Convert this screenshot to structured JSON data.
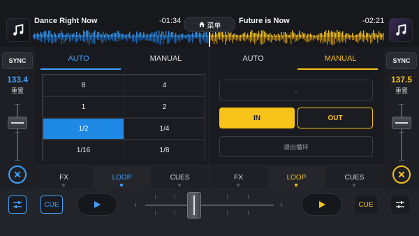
{
  "deck_a": {
    "title": "Dance Right Now",
    "time": "-01:34",
    "bpm": "133.4",
    "reset": "重置",
    "sync": "SYNC",
    "accent": "#3ea2ff",
    "tabs": [
      "AUTO",
      "MANUAL"
    ],
    "active_tab": "AUTO",
    "loop_sizes": [
      "8",
      "4",
      "1",
      "2",
      "1/2",
      "1/4",
      "1/16",
      "1/8"
    ],
    "selected_loop": "1/2",
    "bottom_tabs": [
      "FX",
      "LOOP",
      "CUES"
    ],
    "active_bottom_tab": "LOOP",
    "cue": "CUE"
  },
  "deck_b": {
    "title": "Future is Now",
    "time": "-02:21",
    "bpm": "137.5",
    "reset": "重置",
    "sync": "SYNC",
    "accent": "#f8c318",
    "tabs": [
      "AUTO",
      "MANUAL"
    ],
    "active_tab": "MANUAL",
    "slot": "...",
    "in": "IN",
    "out": "OUT",
    "exit_loop": "退出循环",
    "bottom_tabs": [
      "FX",
      "LOOP",
      "CUES"
    ],
    "active_bottom_tab": "LOOP",
    "cue": "CUE"
  },
  "menu": {
    "label": "菜单"
  },
  "icons": {
    "cover": "music-note-icon",
    "menu": "home-icon",
    "close": "close-icon",
    "mixer": "sliders-icon",
    "play": "play-icon"
  },
  "crossfader": {
    "position": 0.5
  }
}
